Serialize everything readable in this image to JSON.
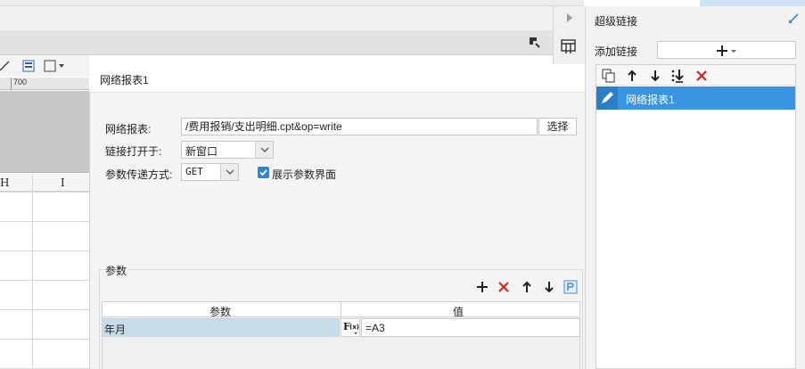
{
  "dialog": {
    "tab_title": "网络报表1",
    "report_label": "网络报表:",
    "report_path": "/费用报销/支出明细.cpt&op=write",
    "choose_button": "选择",
    "open_in_label": "链接打开于:",
    "open_in_value": "新窗口",
    "param_method_label": "参数传递方式:",
    "param_method_value": "GET",
    "show_param_ui_label": "展示参数界面",
    "show_param_ui_checked": true
  },
  "params": {
    "group_title": "参数",
    "columns": [
      "参数",
      "值"
    ],
    "rows": [
      {
        "name": "年月",
        "value": "=A3"
      }
    ]
  },
  "background": {
    "ruler_tick": "700",
    "col_headers": [
      "H",
      "I"
    ]
  },
  "right_panel": {
    "title": "超级链接",
    "add_label": "添加链接",
    "items": [
      {
        "label": "网络报表1",
        "selected": true
      }
    ]
  },
  "colors": {
    "accent": "#3a95e0",
    "delete": "#e02020",
    "param_row": "#c6dcea"
  }
}
